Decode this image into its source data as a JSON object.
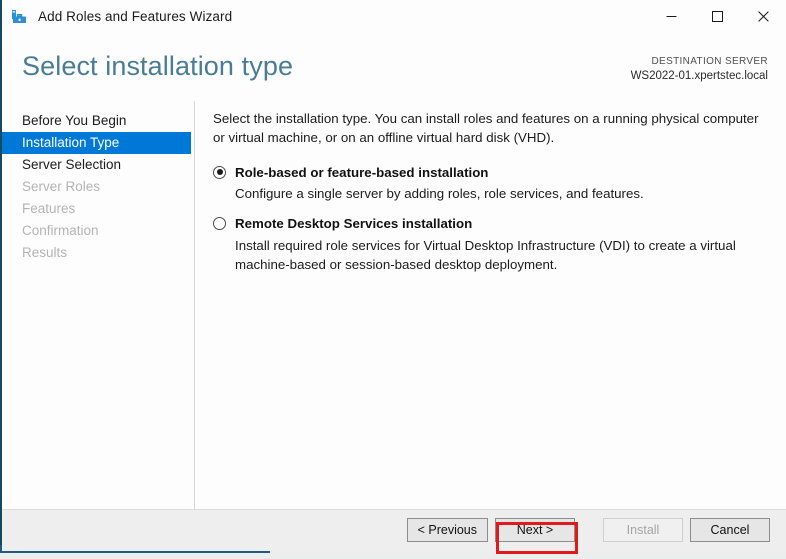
{
  "window": {
    "title": "Add Roles and Features Wizard",
    "icon": "server-manager-toolbox-icon",
    "controls": {
      "minimize": "minimize-icon",
      "maximize": "maximize-icon",
      "close": "close-icon"
    }
  },
  "header": {
    "page_title": "Select installation type",
    "destination_label": "DESTINATION SERVER",
    "destination_value": "WS2022-01.xpertstec.local"
  },
  "nav": {
    "items": [
      {
        "label": "Before You Begin",
        "state": "enabled"
      },
      {
        "label": "Installation Type",
        "state": "selected"
      },
      {
        "label": "Server Selection",
        "state": "enabled"
      },
      {
        "label": "Server Roles",
        "state": "disabled"
      },
      {
        "label": "Features",
        "state": "disabled"
      },
      {
        "label": "Confirmation",
        "state": "disabled"
      },
      {
        "label": "Results",
        "state": "disabled"
      }
    ]
  },
  "main": {
    "intro": "Select the installation type. You can install roles and features on a running physical computer or virtual machine, or on an offline virtual hard disk (VHD).",
    "options": [
      {
        "label": "Role-based or feature-based installation",
        "description": "Configure a single server by adding roles, role services, and features.",
        "selected": true
      },
      {
        "label": "Remote Desktop Services installation",
        "description": "Install required role services for Virtual Desktop Infrastructure (VDI) to create a virtual machine-based or session-based desktop deployment.",
        "selected": false
      }
    ]
  },
  "footer": {
    "previous_label": "< Previous",
    "next_label": "Next >",
    "install_label": "Install",
    "cancel_label": "Cancel",
    "install_disabled": true,
    "highlight_color": "#e01b1b",
    "highlighted_button": "Next >"
  },
  "colors": {
    "accent_blue": "#0078d7",
    "title_text": "#4a7c95",
    "window_border": "#17495e",
    "annotation_red": "#e01b1b"
  }
}
